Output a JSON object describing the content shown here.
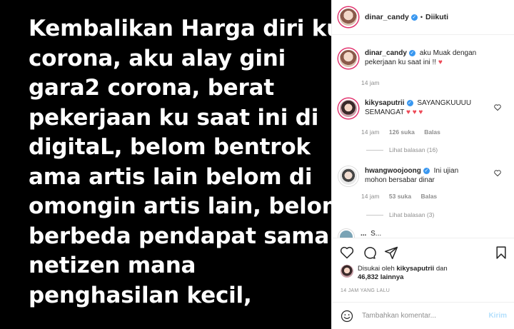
{
  "post": {
    "lines": [
      "Kembalikan Harga diri ku",
      "corona, aku alay gini",
      "gara2 corona, berat",
      "pekerjaan ku saat ini di",
      "digitaL, belom bentrok",
      "ama artis lain belom di",
      "omongin artis lain, belom",
      "berbeda pendapat sama",
      "netizen mana",
      "penghasilan kecil,"
    ]
  },
  "header": {
    "username": "dinar_candy",
    "separator": "•",
    "follow_label": "Diikuti"
  },
  "caption": {
    "username": "dinar_candy",
    "text": "aku Muak dengan pekerjaan ku saat ini !!",
    "heart": "♥",
    "time": "14 jam"
  },
  "comments": [
    {
      "username": "kikysaputrii",
      "text": "SAYANGKUUUU SEMANGAT",
      "hearts": "♥ ♥ ♥",
      "time": "14 jam",
      "likes": "126 suka",
      "reply_label": "Balas",
      "view_replies": "Lihat balasan (16)"
    },
    {
      "username": "hwangwoojoong",
      "text": "Ini ujian mohon bersabar dinar",
      "time": "14 jam",
      "likes": "53 suka",
      "reply_label": "Balas",
      "view_replies": "Lihat balasan (3)"
    }
  ],
  "partial_comment": {
    "username": "...",
    "text": "S..."
  },
  "likes": {
    "prefix": "Disukai oleh",
    "user": "kikysaputrii",
    "conj": "dan",
    "count": "46,832 lainnya"
  },
  "time_ago": "14 JAM YANG LALU",
  "comment_box": {
    "placeholder": "Tambahkan komentar...",
    "post_label": "Kirim"
  },
  "colors": {
    "accent": "#3897f0",
    "heart": "#ed4956",
    "post_disabled": "#b2dffc"
  }
}
